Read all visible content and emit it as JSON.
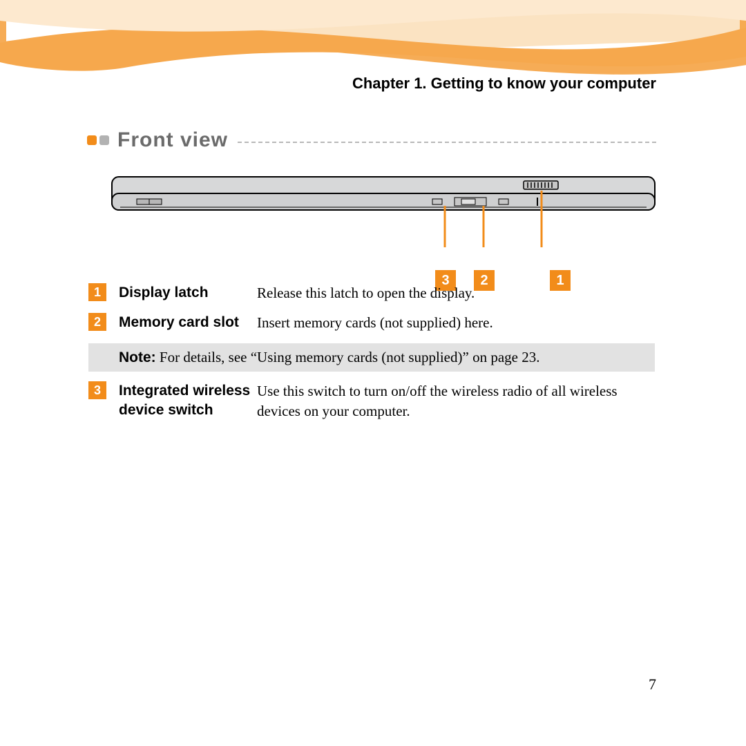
{
  "chapter_title": "Chapter 1. Getting to know your computer",
  "section_title": "Front view",
  "callouts": {
    "c1": "3",
    "c2": "2",
    "c3": "1"
  },
  "items": [
    {
      "num": "1",
      "term": "Display latch",
      "desc": "Release this latch to open the display."
    },
    {
      "num": "2",
      "term": "Memory card slot",
      "desc": "Insert memory cards (not supplied) here."
    },
    {
      "num": "3",
      "term": "Integrated wireless device switch",
      "desc": "Use this switch to turn on/off the wireless radio of all wireless devices on your computer."
    }
  ],
  "note": {
    "label": "Note:",
    "text": " For details, see “Using memory cards (not supplied)” on page 23."
  },
  "page_number": "7"
}
